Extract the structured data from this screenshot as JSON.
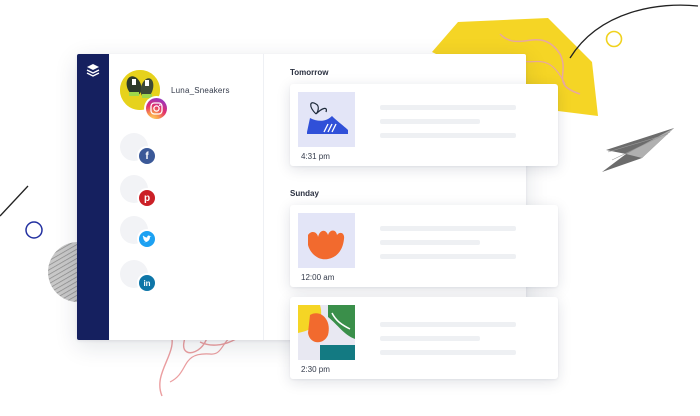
{
  "profile": {
    "username": "Luna_Sneakers",
    "avatar_icon": "sneaker-photo",
    "network_badge_icon": "instagram-icon"
  },
  "social_networks": [
    {
      "name": "facebook",
      "icon": "facebook-icon",
      "glyph": "f",
      "color": "#3b5998"
    },
    {
      "name": "pinterest",
      "icon": "pinterest-icon",
      "glyph": "p",
      "color": "#cb2027"
    },
    {
      "name": "twitter",
      "icon": "twitter-icon",
      "glyph": "t",
      "color": "#1da1f2"
    },
    {
      "name": "linkedin",
      "icon": "linkedin-icon",
      "glyph": "in",
      "color": "#0e76a8"
    }
  ],
  "schedule": [
    {
      "day": "Tomorrow",
      "posts": [
        {
          "time": "4:31 pm",
          "thumbnail": "blue-sneaker-illustration"
        }
      ]
    },
    {
      "day": "Sunday",
      "posts": [
        {
          "time": "12:00 am",
          "thumbnail": "orange-hand-illustration"
        },
        {
          "time": "2:30 pm",
          "thumbnail": "colorful-collage-illustration"
        }
      ]
    }
  ],
  "colors": {
    "nav_rail": "#15205f",
    "accent_yellow": "#f5d525",
    "sneaker_blue": "#3050d8",
    "hand_orange": "#f26a2e"
  }
}
